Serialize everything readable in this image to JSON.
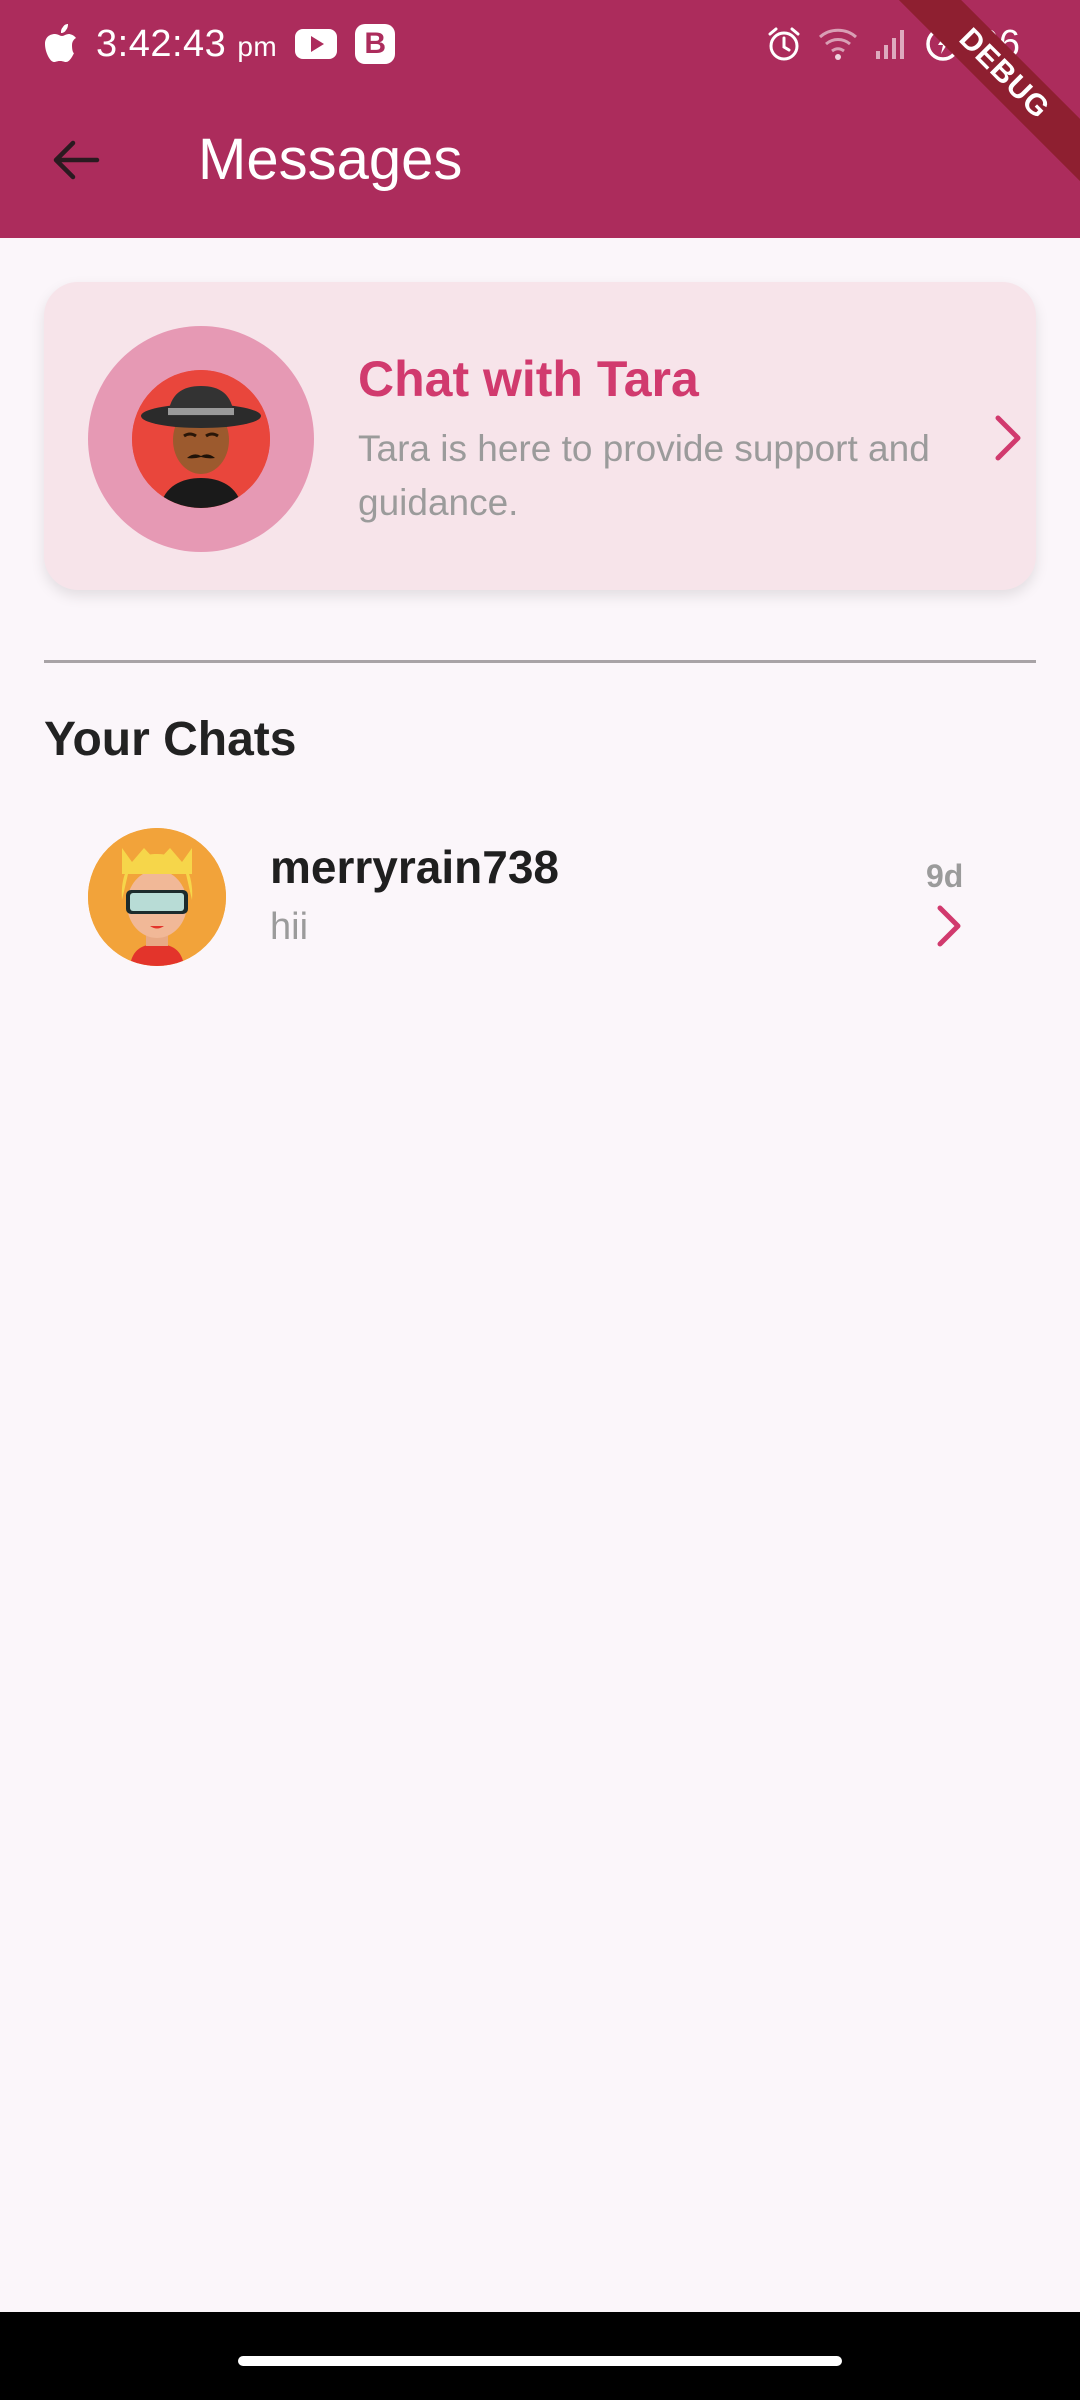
{
  "status_bar": {
    "time": "3:42:43",
    "ampm": "pm",
    "battery": "96",
    "icons": [
      "apple-icon",
      "youtube-icon",
      "b-app-icon",
      "alarm-icon",
      "wifi-icon",
      "signal-icon",
      "battery-icon"
    ]
  },
  "debug_banner": "DEBUG",
  "app_bar": {
    "title": "Messages",
    "back_icon": "arrow-left-icon"
  },
  "tara_card": {
    "title": "Chat with Tara",
    "subtitle": "Tara is here to provide support and guidance."
  },
  "chats": {
    "heading": "Your Chats",
    "items": [
      {
        "name": "merryrain738",
        "preview": "hii",
        "time": "9d"
      }
    ]
  },
  "colors": {
    "app_bar": "#ac2c5c",
    "accent": "#d13a6e",
    "card_bg": "#f7e4ea",
    "page_bg": "#fbf6fa"
  }
}
